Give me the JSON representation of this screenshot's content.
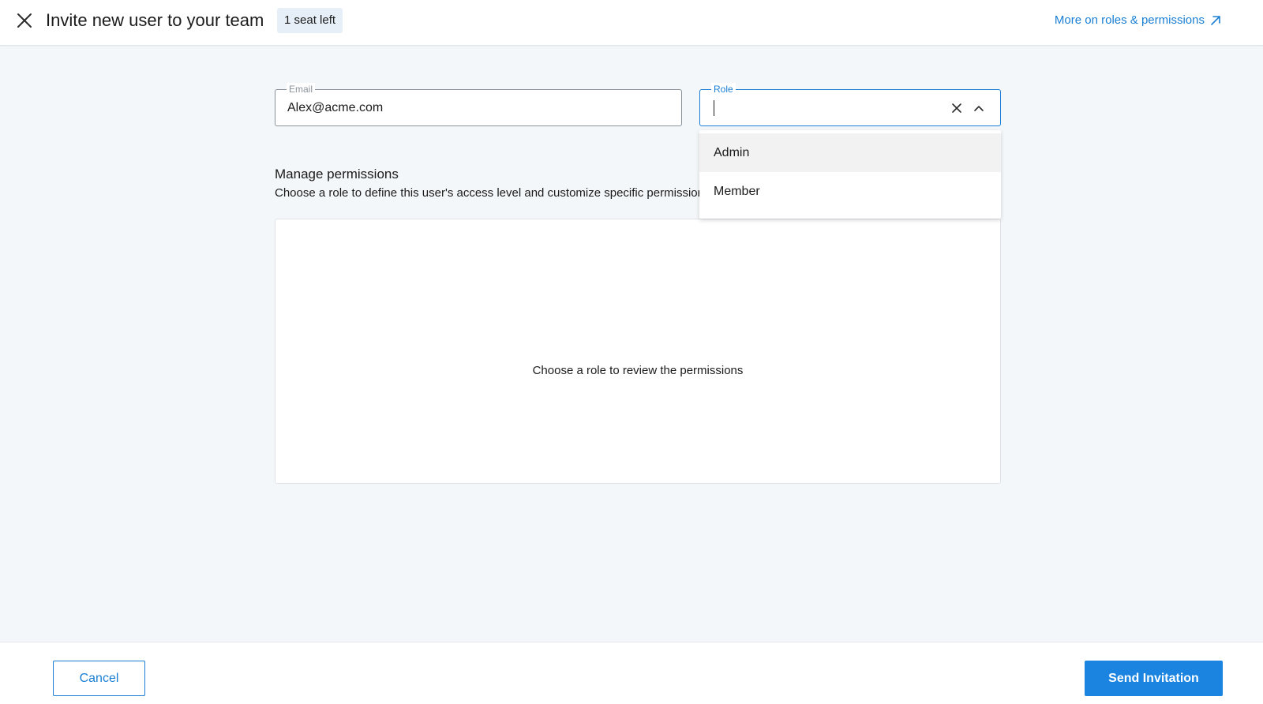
{
  "header": {
    "title": "Invite new user to your team",
    "seat_badge": "1 seat left",
    "roles_link": "More on roles & permissions",
    "close_icon": "close-icon",
    "external_icon": "arrow-up-right-icon"
  },
  "form": {
    "email": {
      "label": "Email",
      "value": "Alex@acme.com"
    },
    "role": {
      "label": "Role",
      "value": "",
      "options": [
        "Admin",
        "Member"
      ],
      "highlighted_option": "Admin"
    }
  },
  "permissions": {
    "title": "Manage permissions",
    "description": "Choose a role to define this user's access level and customize specific permissions",
    "empty_state": "Choose a role to review the permissions"
  },
  "footer": {
    "cancel_label": "Cancel",
    "send_label": "Send Invitation"
  },
  "colors": {
    "accent": "#1a7fd4",
    "primary_button": "#1a84e0",
    "background": "#f4f7fa",
    "badge_bg": "#e6eff8"
  }
}
